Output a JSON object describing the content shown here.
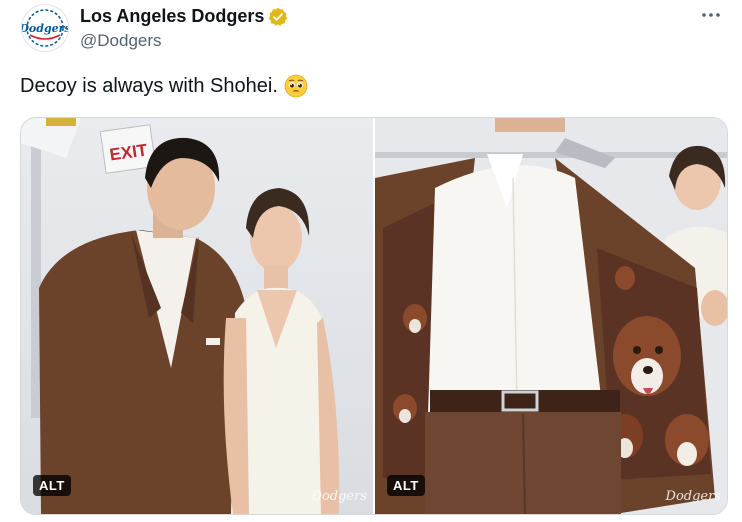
{
  "tweet": {
    "display_name": "Los Angeles Dodgers",
    "handle": "@Dodgers",
    "more_label": "•••",
    "text": "Decoy is always with Shohei.",
    "emoji": "pleading-face",
    "avatar": {
      "logo_text": "Dodgers"
    },
    "colors": {
      "dodger_blue": "#005a9c",
      "verified_gold": "#e2b719",
      "handle_gray": "#536471"
    }
  },
  "media": {
    "photos": [
      {
        "alt_badge": "ALT",
        "watermark": "Dodgers",
        "sign_text": "EXIT"
      },
      {
        "alt_badge": "ALT",
        "watermark": "Dodgers"
      }
    ]
  }
}
